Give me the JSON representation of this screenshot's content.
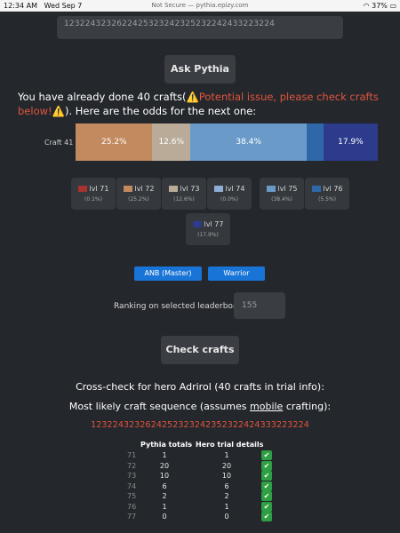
{
  "statusbar": {
    "time": "12:34 AM",
    "date": "Wed Sep 7",
    "url": "Not Secure — pythia.epizy.com",
    "battery": "37%"
  },
  "input": {
    "value": "1232243232622425323242325232242433223224"
  },
  "ask_button": "Ask Pythia",
  "status": {
    "prefix": "You have already done 40 crafts(",
    "warning": "Potential issue, please check crafts below!",
    "suffix": "). Here are the odds for the next one:"
  },
  "chart_data": {
    "type": "bar",
    "categories": [
      "lvl 71",
      "lvl 72",
      "lvl 73",
      "lvl 74",
      "lvl 75",
      "lvl 76",
      "lvl 77"
    ],
    "row_label": "Craft 41",
    "values": [
      0.1,
      25.2,
      12.6,
      0.0,
      38.4,
      5.5,
      17.9
    ],
    "shown_labels": [
      "",
      "25.2%",
      "12.6%",
      "",
      "38.4%",
      "",
      "17.9%"
    ],
    "colors": [
      "#a8322d",
      "#c28a5f",
      "#b9ab98",
      "#8eaed4",
      "#6a9bc8",
      "#2f68a8",
      "#2d3b8c"
    ],
    "legend": [
      {
        "label": "lvl 71",
        "pct": "(0.1%)"
      },
      {
        "label": "lvl 72",
        "pct": "(25.2%)"
      },
      {
        "label": "lvl 73",
        "pct": "(12.6%)"
      },
      {
        "label": "lvl 74",
        "pct": "(0.0%)"
      },
      {
        "label": "lvl 75",
        "pct": "(38.4%)"
      },
      {
        "label": "lvl 76",
        "pct": "(5.5%)"
      },
      {
        "label": "lvl 77",
        "pct": "(17.9%)"
      }
    ]
  },
  "class_buttons": [
    "ANB (Master)",
    "Warrior"
  ],
  "ranking": {
    "label": "Ranking on selected leaderboard:",
    "value": "155"
  },
  "check_button": "Check crafts",
  "crosscheck": "Cross-check for hero Adrirol (40 crafts in trial info):",
  "likely": {
    "before": "Most likely craft sequence (assumes ",
    "mobile": "mobile",
    "after": " crafting):"
  },
  "sequence": "1232243232624252323242352322424333223224",
  "table": {
    "headers": [
      "Pythia totals",
      "Hero trial details"
    ],
    "rows": [
      {
        "lvl": "71",
        "pythia": "1",
        "hero": "1",
        "ok": "✔"
      },
      {
        "lvl": "72",
        "pythia": "20",
        "hero": "20",
        "ok": "✔"
      },
      {
        "lvl": "73",
        "pythia": "10",
        "hero": "10",
        "ok": "✔"
      },
      {
        "lvl": "74",
        "pythia": "6",
        "hero": "6",
        "ok": "✔"
      },
      {
        "lvl": "75",
        "pythia": "2",
        "hero": "2",
        "ok": "✔"
      },
      {
        "lvl": "76",
        "pythia": "1",
        "hero": "1",
        "ok": "✔"
      },
      {
        "lvl": "77",
        "pythia": "0",
        "hero": "0",
        "ok": "✔"
      }
    ]
  }
}
